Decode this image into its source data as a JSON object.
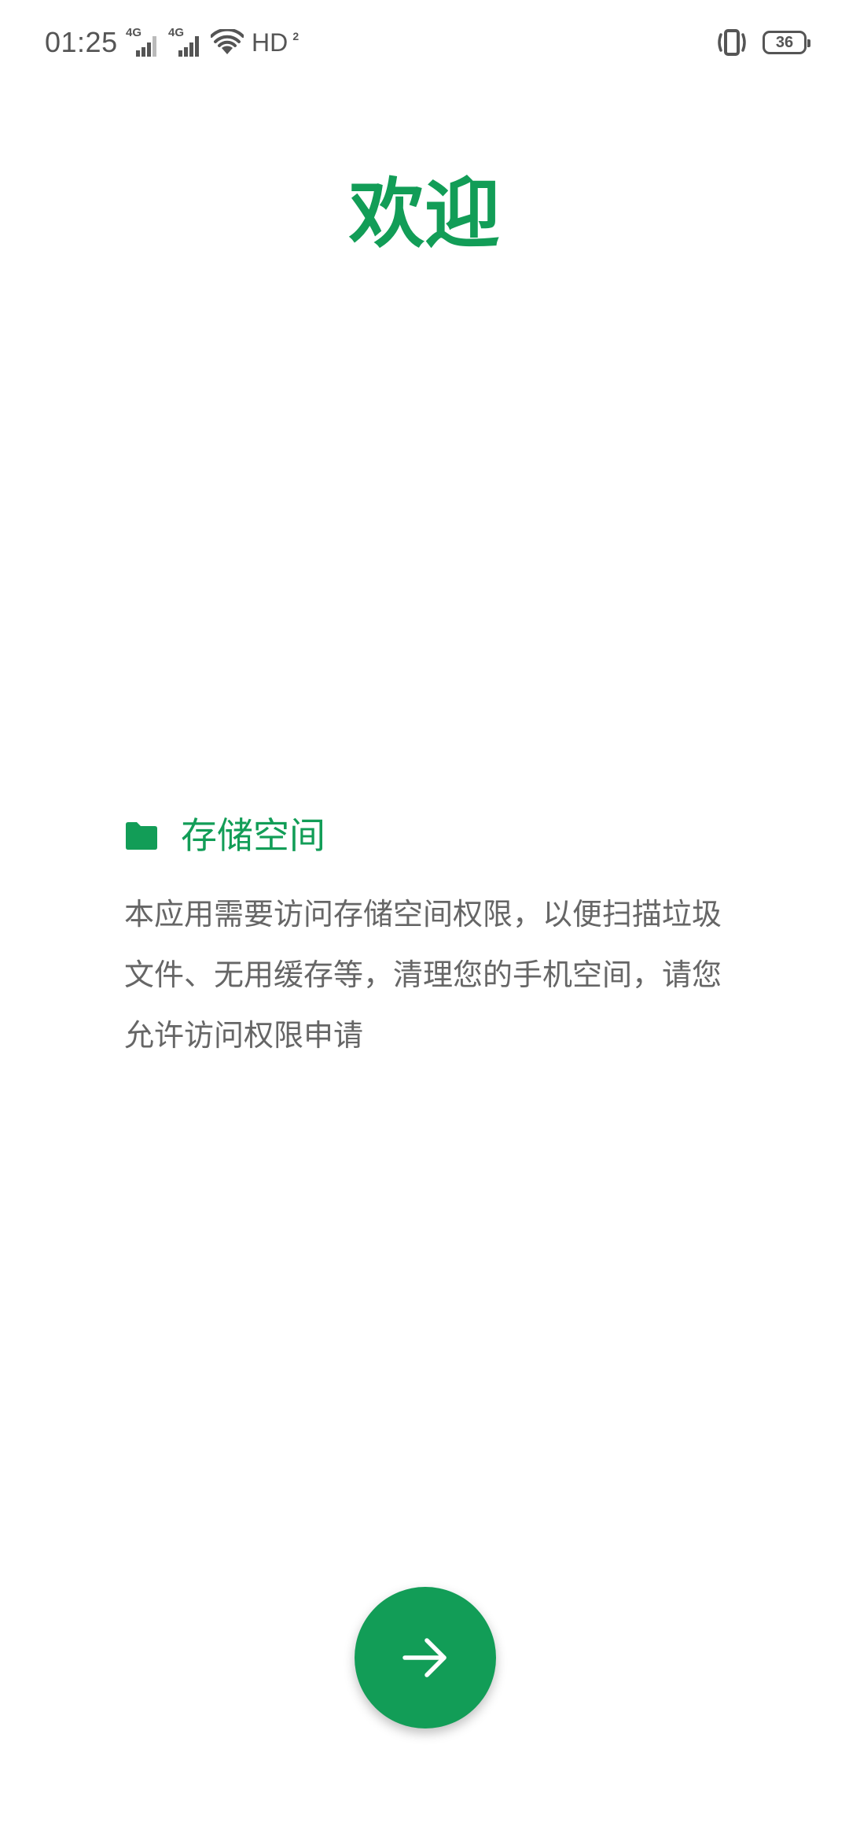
{
  "status_bar": {
    "time": "01:25",
    "sim1_type": "4G",
    "sim2_type": "4G",
    "hd_label": "HD",
    "hd_sub": "2",
    "battery_level": "36"
  },
  "page": {
    "title": "欢迎"
  },
  "permission": {
    "icon": "folder-icon",
    "title": "存储空间",
    "description": "本应用需要访问存储空间权限，以便扫描垃圾文件、无用缓存等，清理您的手机空间，请您允许访问权限申请"
  },
  "fab": {
    "icon": "arrow-right-icon"
  },
  "colors": {
    "accent": "#129d57",
    "text_secondary": "#666666",
    "status_text": "#555555",
    "background": "#ffffff"
  }
}
